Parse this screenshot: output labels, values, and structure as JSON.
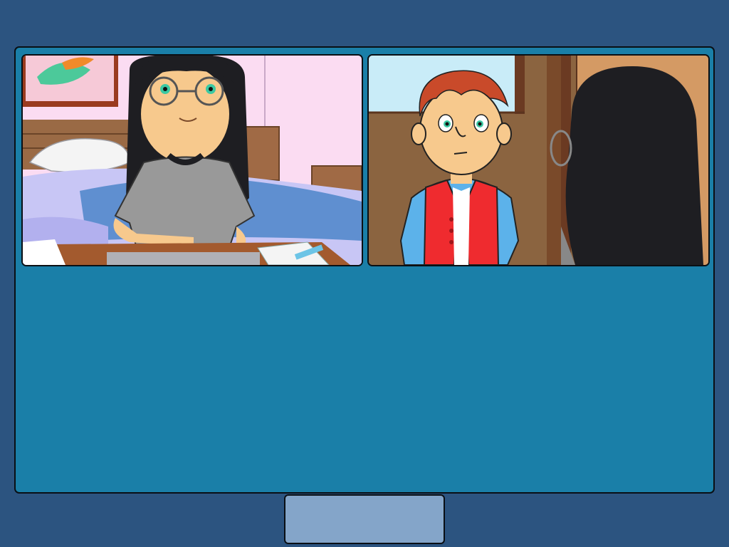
{
  "game": {
    "scene": {
      "panels": [
        {
          "id": "left",
          "characters": [
            "girl-with-glasses"
          ],
          "setting": "bedroom"
        },
        {
          "id": "right",
          "characters": [
            "red-haired-boy",
            "girl-with-glasses-back-view"
          ],
          "setting": "doorway"
        }
      ],
      "dialogue_text": ""
    },
    "controls": {
      "continue_label": ""
    },
    "colors": {
      "background": "#2c5480",
      "stage": "#1a7fa8",
      "button": "#84a5c9",
      "border": "#0a0f14"
    }
  }
}
